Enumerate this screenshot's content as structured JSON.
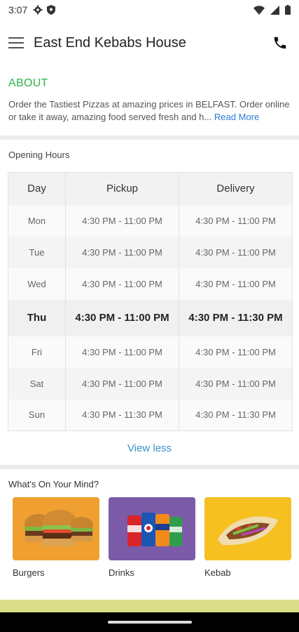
{
  "status_bar": {
    "time": "3:07",
    "icons": [
      "settings-icon",
      "shield-icon",
      "wifi-icon",
      "signal-icon",
      "battery-icon"
    ]
  },
  "app_bar": {
    "title": "East End Kebabs House",
    "menu_icon": "hamburger-icon",
    "call_icon": "phone-icon"
  },
  "about": {
    "heading": "ABOUT",
    "text": "Order the Tastiest Pizzas at amazing prices in BELFAST. Order online or take it away, amazing food served fresh and h...",
    "read_more": "Read More"
  },
  "opening_hours": {
    "title": "Opening Hours",
    "columns": [
      "Day",
      "Pickup",
      "Delivery"
    ],
    "rows": [
      {
        "day": "Mon",
        "pickup": "4:30 PM - 11:00 PM",
        "delivery": "4:30 PM - 11:00 PM",
        "today": false
      },
      {
        "day": "Tue",
        "pickup": "4:30 PM - 11:00 PM",
        "delivery": "4:30 PM - 11:00 PM",
        "today": false
      },
      {
        "day": "Wed",
        "pickup": "4:30 PM - 11:00 PM",
        "delivery": "4:30 PM - 11:00 PM",
        "today": false
      },
      {
        "day": "Thu",
        "pickup": "4:30 PM - 11:00 PM",
        "delivery": "4:30 PM - 11:30 PM",
        "today": true
      },
      {
        "day": "Fri",
        "pickup": "4:30 PM - 11:00 PM",
        "delivery": "4:30 PM - 11:00 PM",
        "today": false
      },
      {
        "day": "Sat",
        "pickup": "4:30 PM - 11:00 PM",
        "delivery": "4:30 PM - 11:00 PM",
        "today": false
      },
      {
        "day": "Sun",
        "pickup": "4:30 PM - 11:30 PM",
        "delivery": "4:30 PM - 11:30 PM",
        "today": false
      }
    ],
    "toggle_label": "View less"
  },
  "whats_on_your_mind": {
    "title": "What's On Your Mind?",
    "categories": [
      {
        "label": "Burgers",
        "color": "#f0a030",
        "icon": "burger-icon"
      },
      {
        "label": "Drinks",
        "color": "#7b5ba8",
        "icon": "cans-icon"
      },
      {
        "label": "Kebab",
        "color": "#f5c020",
        "icon": "kebab-icon"
      }
    ]
  },
  "colors": {
    "accent_green": "#2db34a",
    "link_blue": "#2a7fd4",
    "banner": "#d9dd88"
  }
}
